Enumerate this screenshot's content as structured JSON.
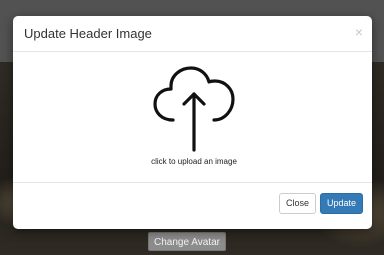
{
  "modal": {
    "title": "Update Header Image",
    "close_icon": "×",
    "upload": {
      "icon": "cloud-upload-icon",
      "text": "click to upload an image"
    },
    "buttons": {
      "close_label": "Close",
      "update_label": "Update"
    }
  },
  "background": {
    "change_avatar_label": "Change Avatar"
  },
  "colors": {
    "primary": "#337ab7",
    "backdrop": "rgba(0,0,0,0.25)"
  }
}
